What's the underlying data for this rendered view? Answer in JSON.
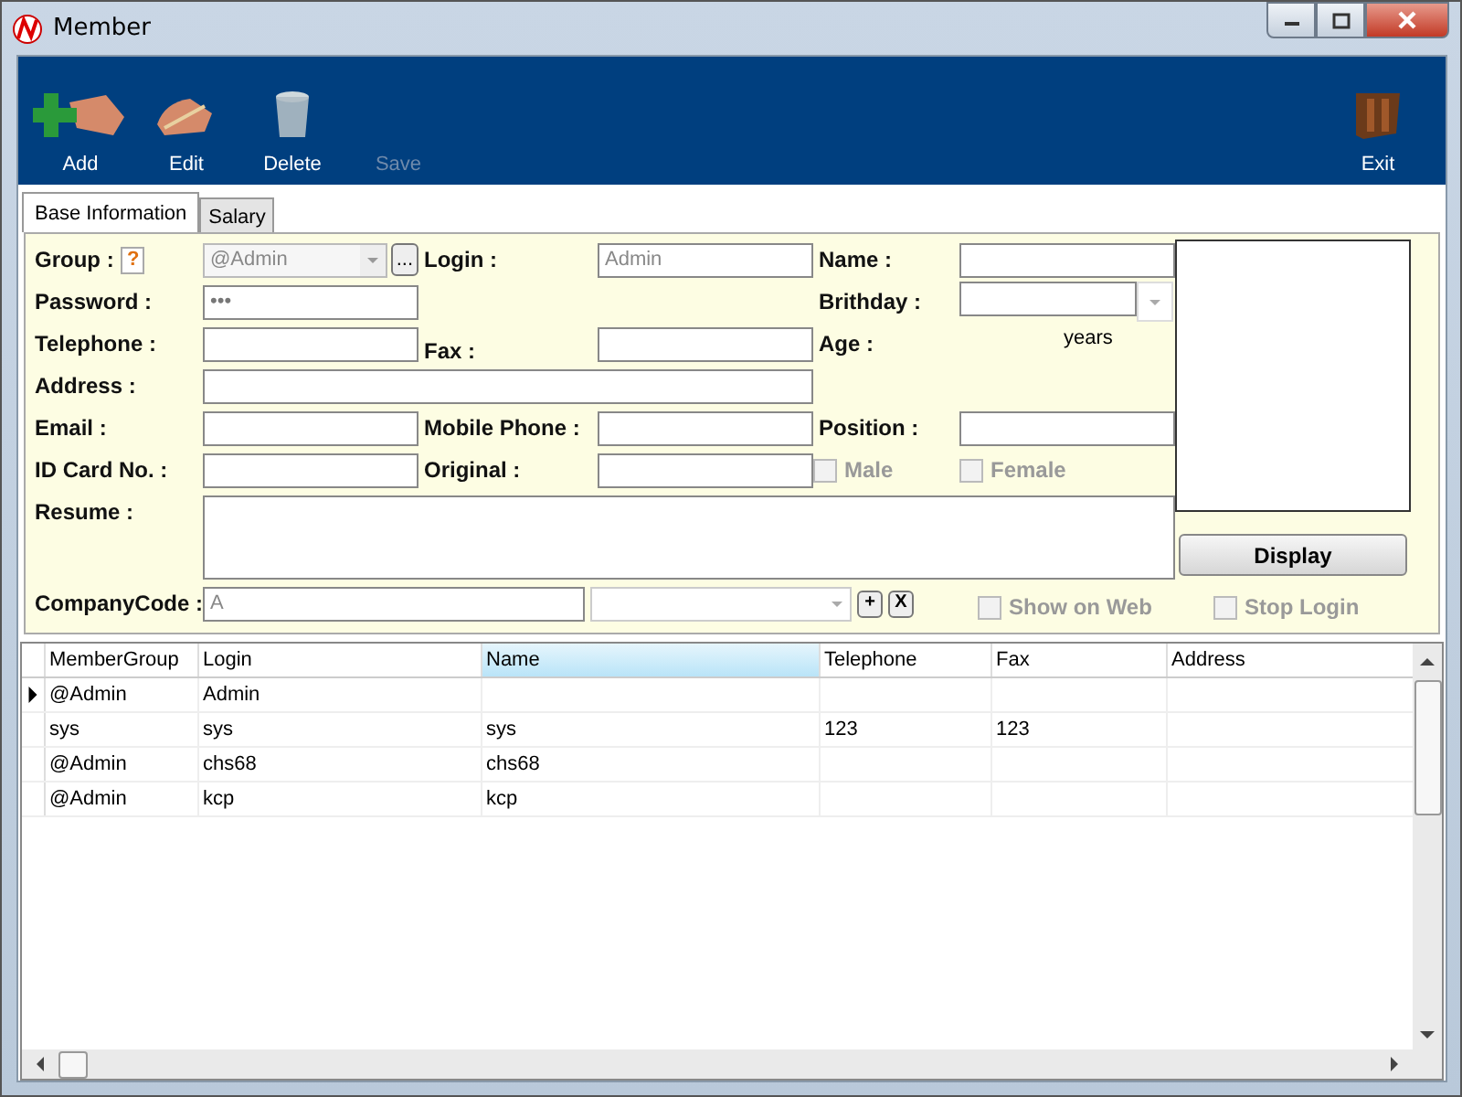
{
  "window": {
    "title": "Member"
  },
  "toolbar": [
    {
      "label": "Add",
      "kind": "add",
      "disabled": false
    },
    {
      "label": "Edit",
      "kind": "edit",
      "disabled": false
    },
    {
      "label": "Delete",
      "kind": "delete",
      "disabled": false
    },
    {
      "label": "Save",
      "kind": "save",
      "disabled": true
    },
    {
      "label": "Exit",
      "kind": "exit",
      "disabled": false
    }
  ],
  "tabs": [
    {
      "label": "Base Information",
      "selected": true
    },
    {
      "label": "Salary",
      "selected": false
    }
  ],
  "form": {
    "group": {
      "label": "Group :",
      "help": "?",
      "value": "@Admin",
      "browse": "...",
      "disabled": true
    },
    "login": {
      "label": "Login :",
      "value": "Admin",
      "disabled": true
    },
    "name": {
      "label": "Name :"
    },
    "password": {
      "label": "Password :",
      "value": "•••"
    },
    "birthday": {
      "label": "Brithday :"
    },
    "telephone": {
      "label": "Telephone :"
    },
    "fax": {
      "label": "Fax :"
    },
    "age": {
      "label": "Age :",
      "unit": "years"
    },
    "address": {
      "label": "Address :"
    },
    "email": {
      "label": "Email :"
    },
    "mobile_phone": {
      "label": "Mobile Phone :"
    },
    "position": {
      "label": "Position :"
    },
    "id_card": {
      "label": "ID Card No. :"
    },
    "original": {
      "label": "Original :"
    },
    "gender": [
      {
        "label": "Male",
        "checked": false,
        "disabled": true
      },
      {
        "label": "Female",
        "checked": false,
        "disabled": true
      }
    ],
    "resume": {
      "label": "Resume :"
    },
    "company_code": {
      "label": "CompanyCode :",
      "value": "A",
      "add": "+",
      "remove": "X"
    },
    "options": [
      {
        "label": "Show on Web",
        "checked": false,
        "disabled": true
      },
      {
        "label": "Stop Login",
        "checked": false,
        "disabled": true
      }
    ],
    "photo_button": "Display"
  },
  "grid": {
    "columns": [
      {
        "label": "MemberGroup",
        "selected": false
      },
      {
        "label": "Login",
        "selected": false
      },
      {
        "label": "Name",
        "selected": true
      },
      {
        "label": "Telephone",
        "selected": false
      },
      {
        "label": "Fax",
        "selected": false
      },
      {
        "label": "Address",
        "selected": false
      }
    ],
    "rows": [
      {
        "current": true,
        "cells": [
          "@Admin",
          "Admin",
          null,
          null,
          null,
          null
        ]
      },
      {
        "current": false,
        "cells": [
          "sys",
          "sys",
          "sys",
          "123",
          "123",
          null
        ]
      },
      {
        "current": false,
        "cells": [
          "@Admin",
          "chs68",
          "chs68",
          null,
          null,
          null
        ]
      },
      {
        "current": false,
        "cells": [
          "@Admin",
          "kcp",
          "kcp",
          null,
          null,
          null
        ]
      }
    ]
  }
}
